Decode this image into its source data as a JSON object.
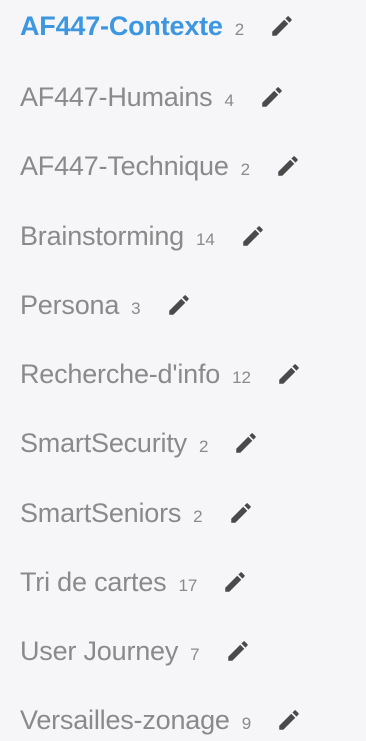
{
  "lists": [
    {
      "label": "AF447-Contexte",
      "count": "2",
      "active": true,
      "icon": "pencil-icon"
    },
    {
      "label": "AF447-Humains",
      "count": "4",
      "active": false,
      "icon": "pencil-icon"
    },
    {
      "label": "AF447-Technique",
      "count": "2",
      "active": false,
      "icon": "pencil-icon"
    },
    {
      "label": "Brainstorming",
      "count": "14",
      "active": false,
      "icon": "pencil-icon"
    },
    {
      "label": "Persona",
      "count": "3",
      "active": false,
      "icon": "pencil-icon"
    },
    {
      "label": "Recherche-d'info",
      "count": "12",
      "active": false,
      "icon": "pencil-icon"
    },
    {
      "label": "SmartSecurity",
      "count": "2",
      "active": false,
      "icon": "pencil-icon"
    },
    {
      "label": "SmartSeniors",
      "count": "2",
      "active": false,
      "icon": "pencil-icon"
    },
    {
      "label": "Tri de cartes",
      "count": "17",
      "active": false,
      "icon": "pencil-icon"
    },
    {
      "label": "User Journey",
      "count": "7",
      "active": false,
      "icon": "pencil-icon"
    },
    {
      "label": "Versailles-zonage",
      "count": "9",
      "active": false,
      "icon": "pencil-icon"
    }
  ],
  "colors": {
    "active": "#3d97e0",
    "text": "#8a8a8a",
    "icon": "#4a4a4a",
    "background": "#f6f6f8"
  }
}
